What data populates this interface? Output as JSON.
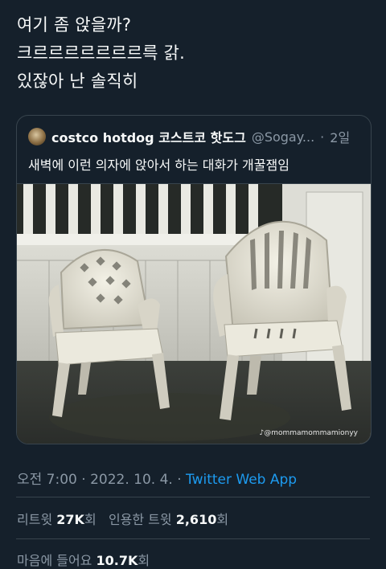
{
  "tweet": {
    "lines": [
      "여기 좀 앉을까?",
      "크르르르르르르르륵 갉.",
      "있잖아 난 솔직히"
    ]
  },
  "quote": {
    "display_name": "costco hotdog 코스트코 핫도그",
    "handle": "@Sogay...",
    "separator": "·",
    "time": "2일",
    "text": "새벽에 이런 의자에 앉아서 하는 대화가 개꿀잼임",
    "photo_credit": "♪@mommamommamionyy"
  },
  "meta": {
    "time": "오전 7:00",
    "sep1": " · ",
    "date": "2022. 10. 4.",
    "sep2": " · ",
    "app": "Twitter Web App"
  },
  "stats": {
    "retweets_label": "리트윗",
    "retweets_value": "27K",
    "retweets_unit": "회",
    "quotes_label": "인용한 트윗",
    "quotes_value": "2,610",
    "quotes_unit": "회",
    "likes_label": "마음에 들어요",
    "likes_value": "10.7K",
    "likes_unit": "회"
  },
  "colors": {
    "background": "#15202b",
    "text": "#f7f9f9",
    "secondary": "#8b98a5",
    "link": "#1d9bf0",
    "border": "#38444d"
  }
}
